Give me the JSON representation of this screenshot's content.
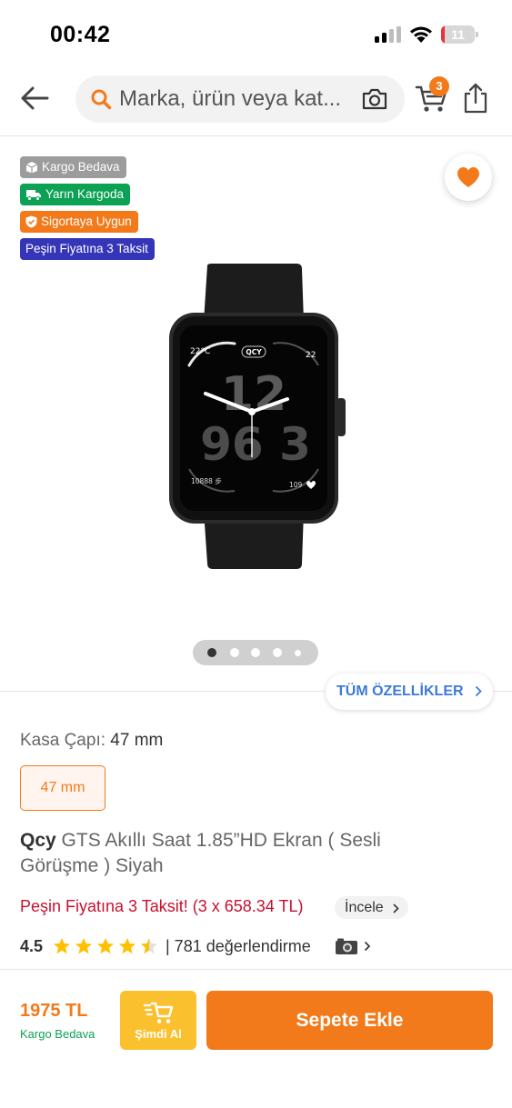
{
  "status_bar": {
    "time": "00:42",
    "battery": "11",
    "battery_percent": 11
  },
  "header": {
    "search_placeholder": "Marka, ürün veya kat...",
    "cart_count": "3",
    "icons": [
      "back-arrow-icon",
      "search-icon",
      "camera-icon",
      "cart-icon",
      "share-icon"
    ]
  },
  "badges": [
    {
      "label": "Kargo Bedava",
      "color": "#9c9c9c",
      "icon": "box-icon"
    },
    {
      "label": "Yarın Kargoda",
      "color": "#0da155",
      "icon": "truck-icon"
    },
    {
      "label": "Sigortaya Uygun",
      "color": "#f27a1a",
      "icon": "shield-icon"
    },
    {
      "label": "Peşin Fiyatına 3 Taksit",
      "color": "#3535b8"
    }
  ],
  "watch_face": {
    "temp": "22°C",
    "brand": "QCY",
    "date": "22",
    "hour_big": "12",
    "digits": "96 3",
    "steps": "10888 步",
    "sec": "109"
  },
  "gallery": {
    "dot_count": 5,
    "active_index": 0
  },
  "specs_button": "TÜM ÖZELLİKLER",
  "variant": {
    "label": "Kasa Çapı:",
    "value": "47 mm",
    "option": "47 mm"
  },
  "product": {
    "brand": "Qcy",
    "name": "GTS Akıllı Saat 1.85”HD Ekran ( Sesli Görüşme )  Siyah"
  },
  "installment": {
    "text": "Peşin Fiyatına 3 Taksit! (3 x 658.34 TL)",
    "review_button": "İncele"
  },
  "rating": {
    "value": "4.5",
    "stars": 4.5,
    "count": "| 781 değerlendirme"
  },
  "bottom_bar": {
    "price": "1975 TL",
    "shipping": "Kargo Bedava",
    "buy_now": "Şimdi Al",
    "add_to_cart": "Sepete Ekle"
  },
  "colors": {
    "accent": "#f27a1a",
    "green": "#0da155",
    "blue": "#3535b8",
    "link": "#3d7bd9",
    "installment": "#c8102e",
    "buy_now": "#fbc02d"
  }
}
